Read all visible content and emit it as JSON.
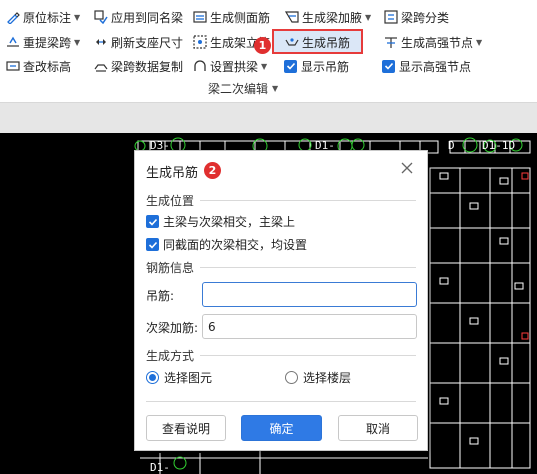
{
  "ribbon": {
    "row1": {
      "original_annotation": "原位标注",
      "apply_same_name": "应用到同名梁",
      "gen_side_rebar": "生成侧面筋",
      "gen_beam_haunch": "生成梁加腋",
      "span_classify": "梁跨分类"
    },
    "row2": {
      "relift_span": "重提梁跨",
      "refresh_support": "刷新支座尺寸",
      "gen_erection_bar": "生成架立筋",
      "gen_hanger_bar": "生成吊筋",
      "gen_high_strength_node": "生成高强节点"
    },
    "row3": {
      "check_elevation": "查改标高",
      "copy_span_data": "梁跨数据复制",
      "set_arch_beam": "设置拱梁",
      "show_hanger_bar": "显示吊筋",
      "show_high_strength_node": "显示高强节点"
    },
    "group_label": "梁二次编辑",
    "badge1": "1"
  },
  "canvas": {
    "labels_top": [
      "D3-",
      "D1-",
      "D",
      "D1-1D"
    ],
    "labels_bottom": "D1-"
  },
  "dialog": {
    "title": "生成吊筋",
    "badge2": "2",
    "section_location": "生成位置",
    "opt_main_secondary": "主梁与次梁相交，主梁上",
    "opt_same_section": "同截面的次梁相交，均设置",
    "section_rebar": "钢筋信息",
    "hanger_label": "吊筋:",
    "hanger_value": "",
    "extra_label": "次梁加筋:",
    "extra_value": "6",
    "section_method": "生成方式",
    "radio_select_element": "选择图元",
    "radio_select_floor": "选择楼层",
    "btn_help": "查看说明",
    "btn_ok": "确定",
    "btn_cancel": "取消"
  },
  "colors": {
    "accent": "#2f7ae5",
    "highlight_border": "#e63b3b",
    "badge": "#e02f2f",
    "cad_green": "#32d232"
  }
}
